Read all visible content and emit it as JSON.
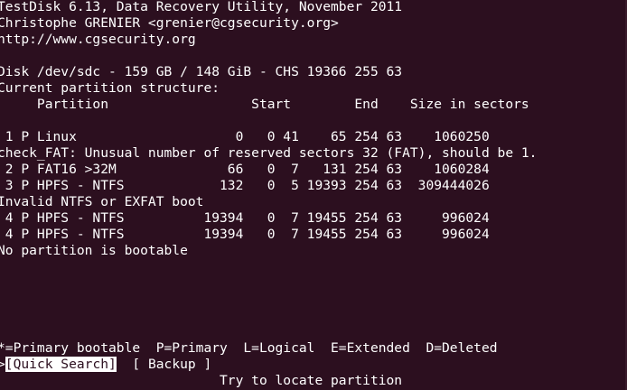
{
  "header": {
    "title_line": "TestDisk 6.13, Data Recovery Utility, November 2011",
    "author_line": "Christophe GRENIER <grenier@cgsecurity.org>",
    "url_line": "http://www.cgsecurity.org"
  },
  "disk": {
    "info_line": "Disk /dev/sdc - 159 GB / 148 GiB - CHS 19366 255 63",
    "structure_heading": "Current partition structure:",
    "columns_header": "     Partition                  Start        End    Size in sectors"
  },
  "partitions": [
    {
      "kind": "row",
      "text": " 1 P Linux                    0   0 41    65 254 63    1060250"
    },
    {
      "kind": "message",
      "text": "check_FAT: Unusual number of reserved sectors 32 (FAT), should be 1."
    },
    {
      "kind": "row",
      "text": " 2 P FAT16 >32M              66   0  7   131 254 63    1060284"
    },
    {
      "kind": "row",
      "text": " 3 P HPFS - NTFS            132   0  5 19393 254 63  309444026"
    },
    {
      "kind": "message",
      "text": "Invalid NTFS or EXFAT boot"
    },
    {
      "kind": "row",
      "text": " 4 P HPFS - NTFS          19394   0  7 19455 254 63     996024"
    },
    {
      "kind": "row",
      "text": " 4 P HPFS - NTFS          19394   0  7 19455 254 63     996024"
    },
    {
      "kind": "message",
      "text": "No partition is bootable"
    }
  ],
  "legend": "*=Primary bootable  P=Primary  L=Logical  E=Extended  D=Deleted",
  "menu": {
    "prefix": ">",
    "quick_search": "[Quick Search]",
    "spacer": "  ",
    "backup": "[ Backup ]"
  },
  "hint": "                            Try to locate partition",
  "colors": {
    "background": "#2c0f1f",
    "foreground": "#ffffff"
  }
}
